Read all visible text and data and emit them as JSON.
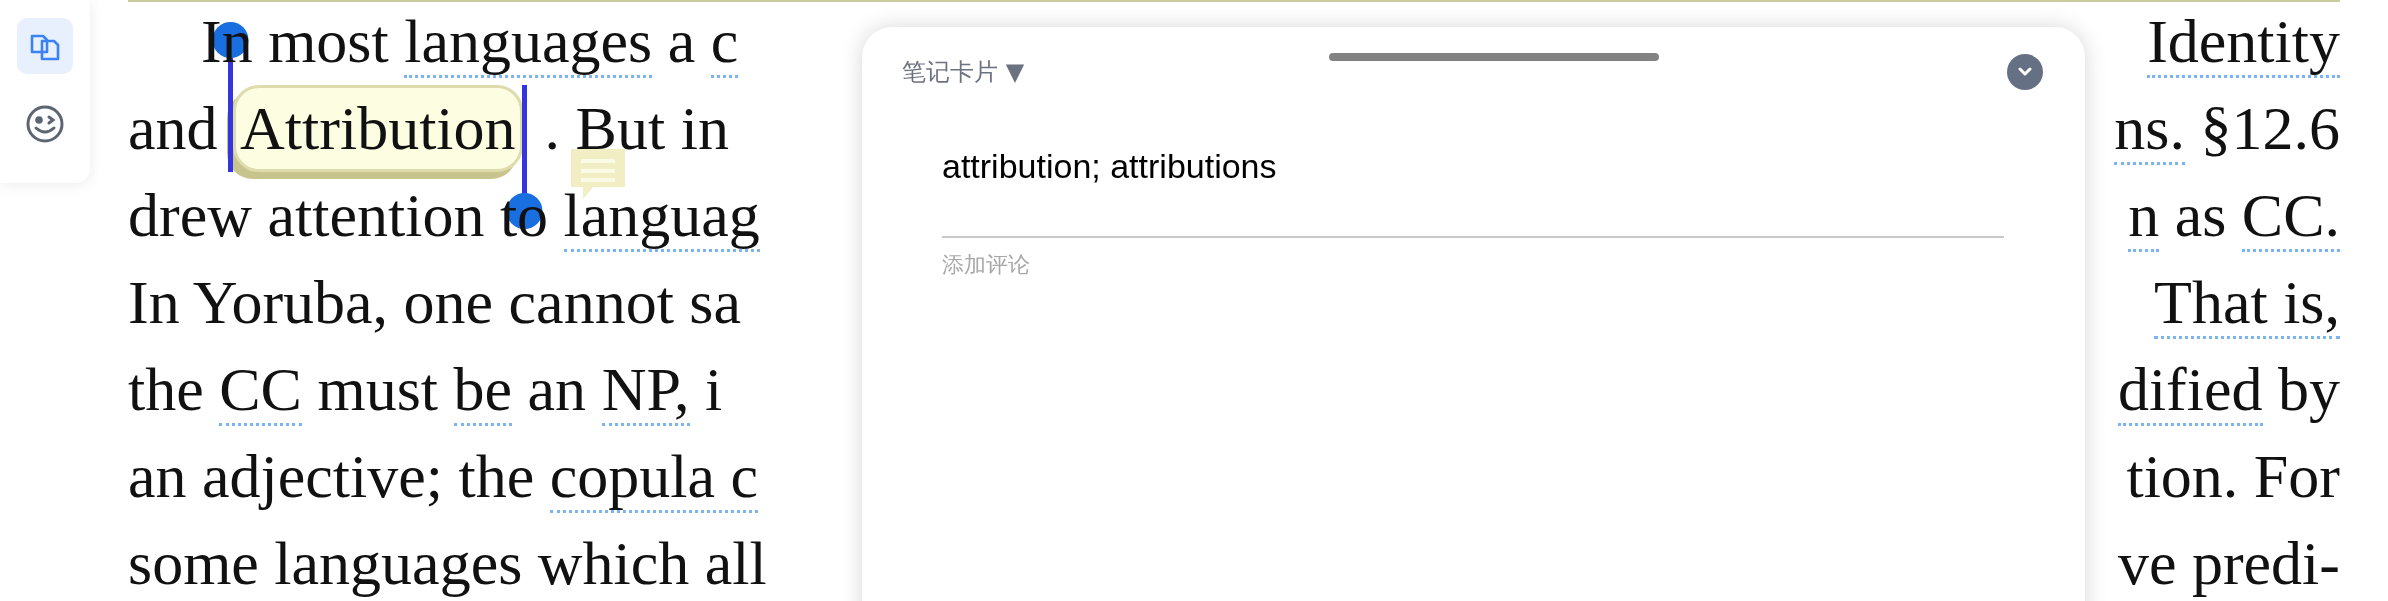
{
  "toolbar": [
    {
      "kind": "copy",
      "selected": true
    },
    {
      "kind": "emoji",
      "selected": false
    }
  ],
  "text_lines": [
    {
      "indent": true,
      "left": [
        {
          "text": "In most ",
          "underlined": false
        },
        {
          "text": "languages",
          "underlined": true
        },
        {
          "text": " a ",
          "underlined": false
        },
        {
          "text": "c",
          "underlined": true
        }
      ],
      "right": [
        {
          "text": "Identity",
          "underlined": true
        }
      ]
    },
    {
      "indent": false,
      "left": [
        {
          "text": "and ",
          "underlined": false
        },
        {
          "text": "Attribution",
          "highlighted": true
        },
        {
          "text": ". But in",
          "underlined": false
        }
      ],
      "right": [
        {
          "text": "ns.",
          "underlined": true
        },
        {
          "text": " §12.6",
          "underlined": false
        }
      ]
    },
    {
      "indent": false,
      "left": [
        {
          "text": "drew attention to ",
          "underlined": false
        },
        {
          "text": "languag",
          "underlined": true
        }
      ],
      "right": [
        {
          "text": "n",
          "underlined": true
        },
        {
          "text": " as ",
          "underlined": false
        },
        {
          "text": "CC.",
          "underlined": true
        }
      ]
    },
    {
      "indent": false,
      "left": [
        {
          "text": "In Yoruba, one cannot sa",
          "underlined": false
        }
      ],
      "right": [
        {
          "text": "That is,",
          "underlined": true
        }
      ]
    },
    {
      "indent": false,
      "left": [
        {
          "text": "the ",
          "underlined": false
        },
        {
          "text": "CC",
          "underlined": true
        },
        {
          "text": " must ",
          "underlined": false
        },
        {
          "text": "be",
          "underlined": true
        },
        {
          "text": " an ",
          "underlined": false
        },
        {
          "text": "NP,",
          "underlined": true
        },
        {
          "text": " i",
          "underlined": false
        }
      ],
      "right": [
        {
          "text": "dified",
          "underlined": true
        },
        {
          "text": " by",
          "underlined": false
        }
      ]
    },
    {
      "indent": false,
      "left": [
        {
          "text": "an adjective; the ",
          "underlined": false
        },
        {
          "text": "copula c",
          "underlined": true
        }
      ],
      "right": [
        {
          "text": "tion. For",
          "underlined": false
        }
      ]
    },
    {
      "indent": false,
      "left": [
        {
          "text": "some languages which all",
          "underlined": false
        }
      ],
      "right": [
        {
          "text": "ve predi-",
          "underlined": false
        }
      ]
    }
  ],
  "note_card": {
    "type_dropdown": "笔记卡片 ▼",
    "headword": "attribution; attributions",
    "comment": {
      "placeholder": "添加评论"
    }
  }
}
